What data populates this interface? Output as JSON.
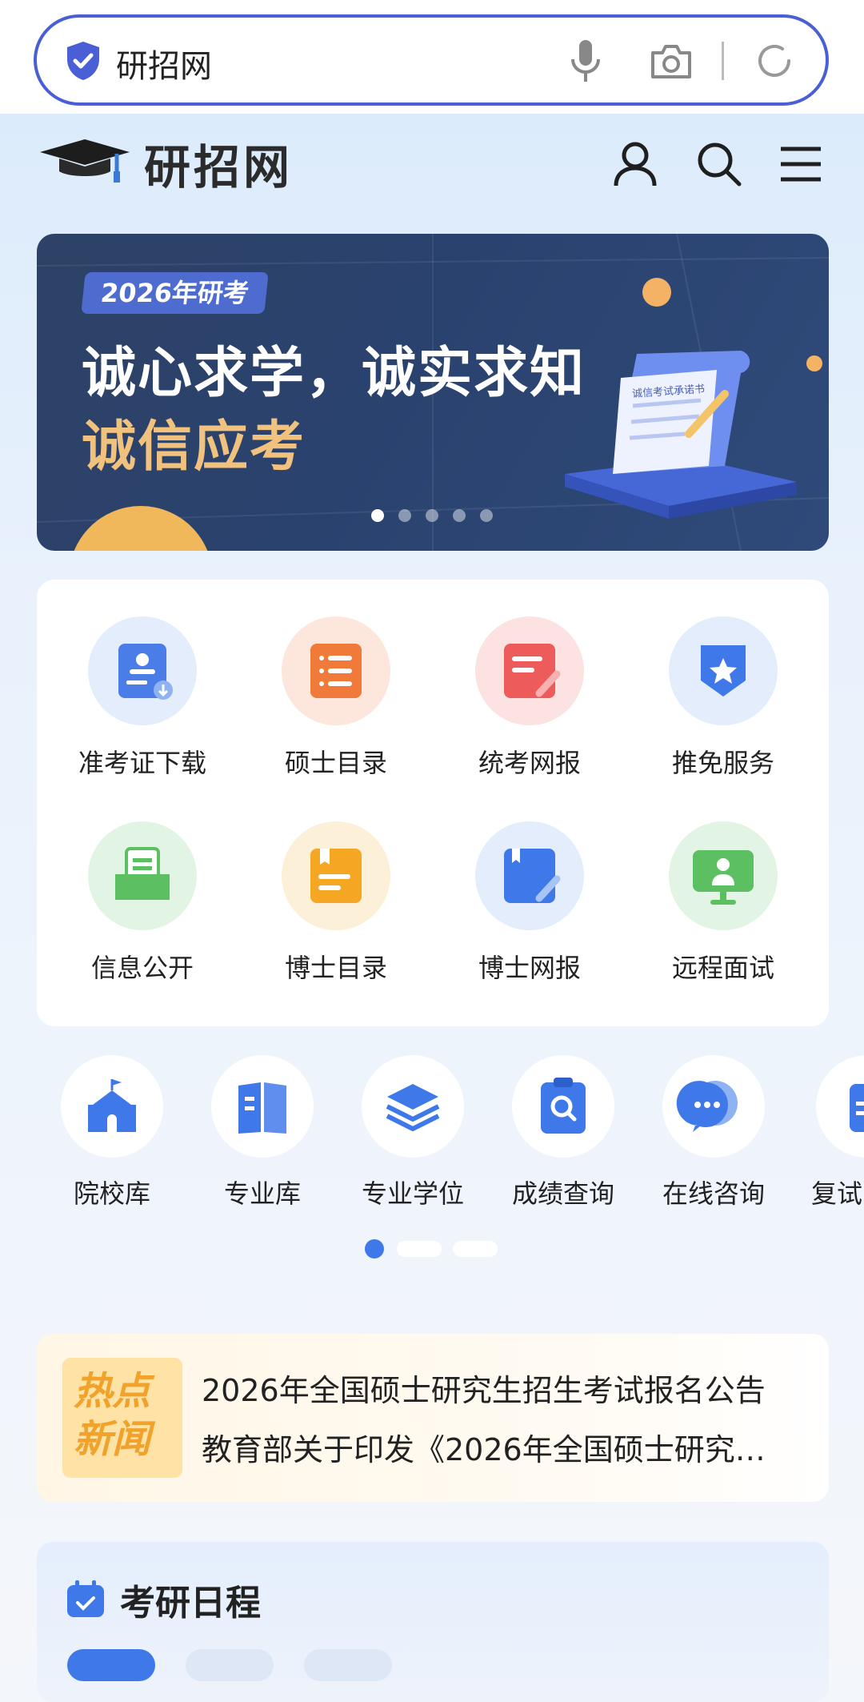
{
  "browser": {
    "url_text": "研招网",
    "icons": [
      "shield-check-icon",
      "mic-icon",
      "camera-icon",
      "refresh-icon"
    ]
  },
  "header": {
    "site_name": "研招网",
    "icons": [
      "grad-cap-logo",
      "user-icon",
      "search-icon",
      "menu-icon"
    ]
  },
  "banner": {
    "tag": "2026年研考",
    "line1": "诚心求学，诚实求知",
    "line2": "诚信应考",
    "doc_label": "诚信考试承诺书",
    "active_slide": 1,
    "slide_count": 5
  },
  "services": {
    "items": [
      {
        "label": "准考证下载",
        "icon": "admit-card-icon",
        "color": "#4a7de8",
        "bg": "#e3edfc"
      },
      {
        "label": "硕士目录",
        "icon": "list-doc-icon",
        "color": "#f07a3a",
        "bg": "#fde6dc"
      },
      {
        "label": "统考网报",
        "icon": "edit-doc-icon",
        "color": "#ee5b5b",
        "bg": "#fde2e2"
      },
      {
        "label": "推免服务",
        "icon": "star-badge-icon",
        "color": "#3f78e8",
        "bg": "#e3edfc"
      },
      {
        "label": "信息公开",
        "icon": "inbox-icon",
        "color": "#5cbf62",
        "bg": "#e2f4e3"
      },
      {
        "label": "博士目录",
        "icon": "bookmark-doc-icon",
        "color": "#f5a623",
        "bg": "#fdf0d8"
      },
      {
        "label": "博士网报",
        "icon": "book-edit-icon",
        "color": "#3f78e8",
        "bg": "#e3edfc"
      },
      {
        "label": "远程面试",
        "icon": "monitor-user-icon",
        "color": "#5cbf62",
        "bg": "#e2f4e3"
      }
    ]
  },
  "quick": {
    "items": [
      {
        "label": "院校库",
        "icon": "school-icon"
      },
      {
        "label": "专业库",
        "icon": "book-icon"
      },
      {
        "label": "专业学位",
        "icon": "layers-icon"
      },
      {
        "label": "成绩查询",
        "icon": "clipboard-search-icon"
      },
      {
        "label": "在线咨询",
        "icon": "chat-icon"
      },
      {
        "label": "复试",
        "icon": "document-icon"
      }
    ],
    "active_page": 1,
    "page_count": 3
  },
  "news": {
    "badge": [
      "热点",
      "新闻"
    ],
    "items": [
      "2026年全国硕士研究生招生考试报名公告",
      "教育部关于印发《2026年全国硕士研究…"
    ]
  },
  "schedule": {
    "title": "考研日程"
  },
  "colors": {
    "primary": "#3f78e8",
    "search_border": "#4a5fd6",
    "banner_gold": "#f1c27e",
    "news_badge": "#ffe2a6",
    "news_badge_text": "#f0a22a"
  }
}
